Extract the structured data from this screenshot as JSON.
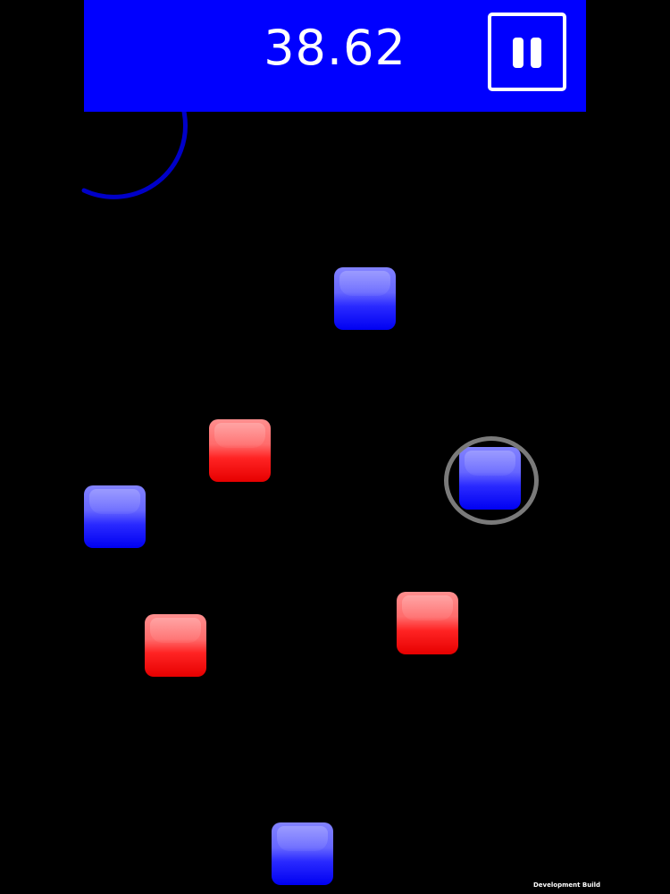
{
  "hud": {
    "timer": "38.62",
    "pause_icon": "pause-icon",
    "background_color": "#0000ff"
  },
  "board": {
    "background_color": "#000000",
    "tiles": [
      {
        "color": "blue"
      },
      {
        "color": "red"
      },
      {
        "color": "blue"
      },
      {
        "color": "blue",
        "selected": true
      },
      {
        "color": "red"
      },
      {
        "color": "red"
      },
      {
        "color": "blue"
      }
    ],
    "tile_colors": {
      "blue": "#0000ff",
      "red": "#ff0000"
    },
    "selection_ring_color": "#7a7a7a",
    "arc_color": "#0000c8"
  },
  "footer": {
    "build_label": "Development Build"
  }
}
